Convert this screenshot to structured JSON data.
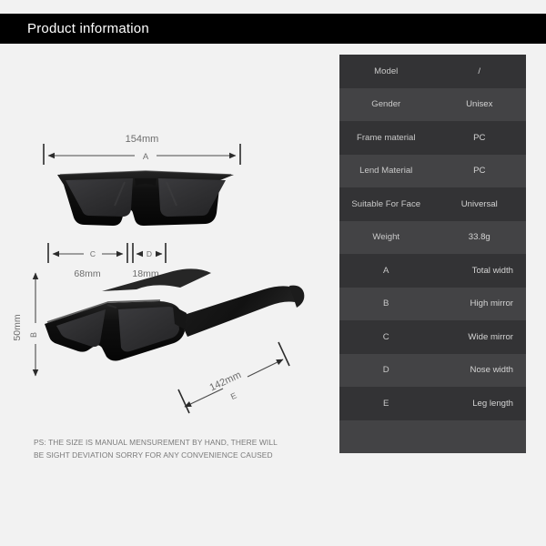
{
  "header": {
    "title": "Product information"
  },
  "diagram": {
    "front_view": {
      "width_label": "154mm",
      "width_key": "A",
      "lens_width_label": "68mm",
      "lens_width_key": "C",
      "bridge_label": "18mm",
      "bridge_key": "D"
    },
    "angled_view": {
      "height_label": "50mm",
      "height_key": "B",
      "temple_label": "142mm",
      "temple_key": "E"
    }
  },
  "footnote": {
    "line1": "PS:  THE SIZE IS MANUAL MENSUREMENT BY HAND, THERE WILL",
    "line2": "BE SIGHT DEVIATION SORRY FOR ANY CONVENIENCE CAUSED"
  },
  "spec_table": {
    "rows": [
      {
        "label": "Model",
        "value": "/",
        "align": "center"
      },
      {
        "label": "Gender",
        "value": "Unisex",
        "align": "center"
      },
      {
        "label": "Frame material",
        "value": "PC",
        "align": "center"
      },
      {
        "label": "Lend Material",
        "value": "PC",
        "align": "center"
      },
      {
        "label": "Suitable For Face",
        "value": "Universal",
        "align": "center"
      },
      {
        "label": "Weight",
        "value": "33.8g",
        "align": "center"
      },
      {
        "label": "A",
        "value": "Total width",
        "align": "right"
      },
      {
        "label": "B",
        "value": "High mirror",
        "align": "right"
      },
      {
        "label": "C",
        "value": "Wide mirror",
        "align": "right"
      },
      {
        "label": "D",
        "value": "Nose width",
        "align": "right"
      },
      {
        "label": "E",
        "value": "Leg length",
        "align": "right"
      },
      {
        "label": "",
        "value": "",
        "align": "center"
      }
    ]
  },
  "colors": {
    "page_background": "#f2f2f2",
    "header_background": "#000000",
    "header_text": "#ffffff",
    "table_row_odd": "#333335",
    "table_row_even": "#434345",
    "table_text": "#cfcfcf",
    "frame_black": "#111111",
    "lens_gray": "#2e2e30",
    "dimension_text": "#6d6d6d"
  }
}
